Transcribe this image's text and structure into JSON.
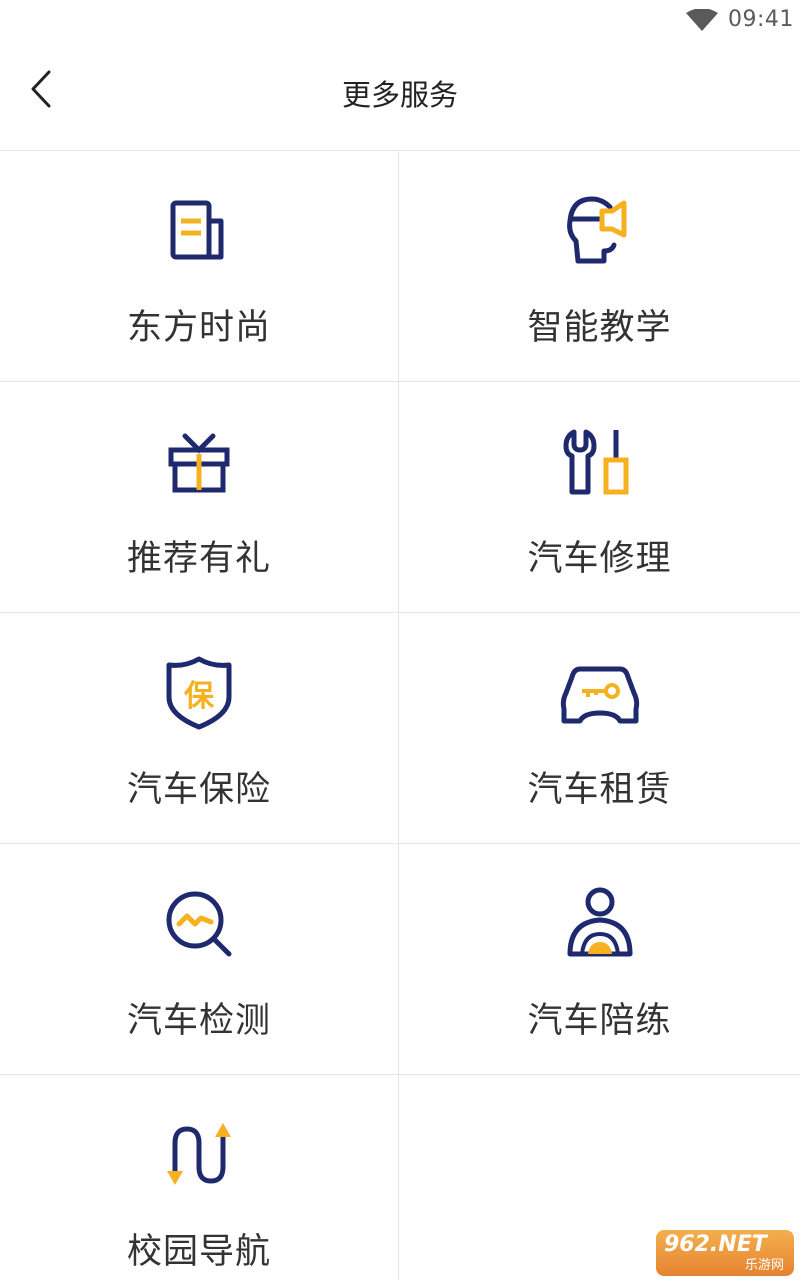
{
  "status_bar": {
    "time": "09:41",
    "wifi_icon": "wifi-icon"
  },
  "header": {
    "title": "更多服务",
    "back_icon": "chevron-left-icon"
  },
  "colors": {
    "navy": "#1f2a6e",
    "accent": "#f5b11f",
    "divider": "#e7e7e7",
    "text": "#333333"
  },
  "services": [
    {
      "label": "东方时尚",
      "icon": "news-icon"
    },
    {
      "label": "智能教学",
      "icon": "smart-teaching-icon"
    },
    {
      "label": "推荐有礼",
      "icon": "gift-icon"
    },
    {
      "label": "汽车修理",
      "icon": "wrench-tools-icon"
    },
    {
      "label": "汽车保险",
      "icon": "shield-insurance-icon",
      "glyph": "保"
    },
    {
      "label": "汽车租赁",
      "icon": "car-key-icon"
    },
    {
      "label": "汽车检测",
      "icon": "inspection-search-icon"
    },
    {
      "label": "汽车陪练",
      "icon": "driver-wheel-icon"
    },
    {
      "label": "校园导航",
      "icon": "route-navigation-icon"
    }
  ],
  "watermark": {
    "main": "962.NET",
    "sub": "乐游网"
  }
}
